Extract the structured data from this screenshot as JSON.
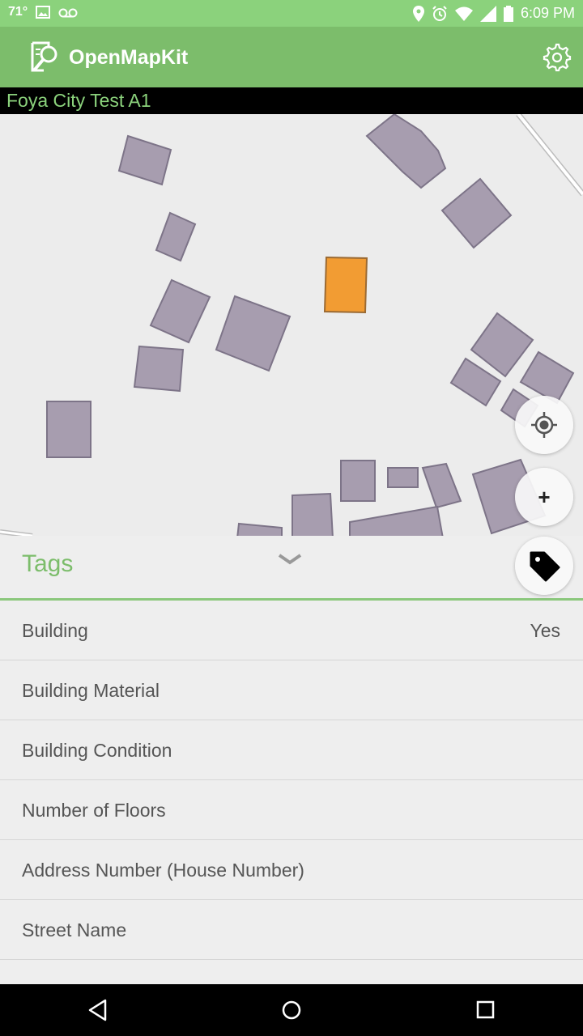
{
  "status": {
    "temperature": "71°",
    "time": "6:09 PM",
    "icons": [
      "image-icon",
      "voicemail-icon",
      "location-icon",
      "alarm-icon",
      "wifi-icon",
      "signal-icon",
      "battery-icon"
    ]
  },
  "app": {
    "title": "OpenMapKit",
    "project": "Foya City Test A1",
    "colors": {
      "status": "#8bd27c",
      "appbar": "#7cbd6b",
      "selected": "#f29c33",
      "building": "#a79daf"
    }
  },
  "tags": {
    "header": "Tags",
    "items": [
      {
        "key": "Building",
        "value": "Yes"
      },
      {
        "key": "Building Material",
        "value": ""
      },
      {
        "key": "Building Condition",
        "value": ""
      },
      {
        "key": "Number of Floors",
        "value": ""
      },
      {
        "key": "Address Number (House Number)",
        "value": ""
      },
      {
        "key": "Street Name",
        "value": ""
      }
    ]
  },
  "map": {
    "zoom_in_label": "+"
  }
}
